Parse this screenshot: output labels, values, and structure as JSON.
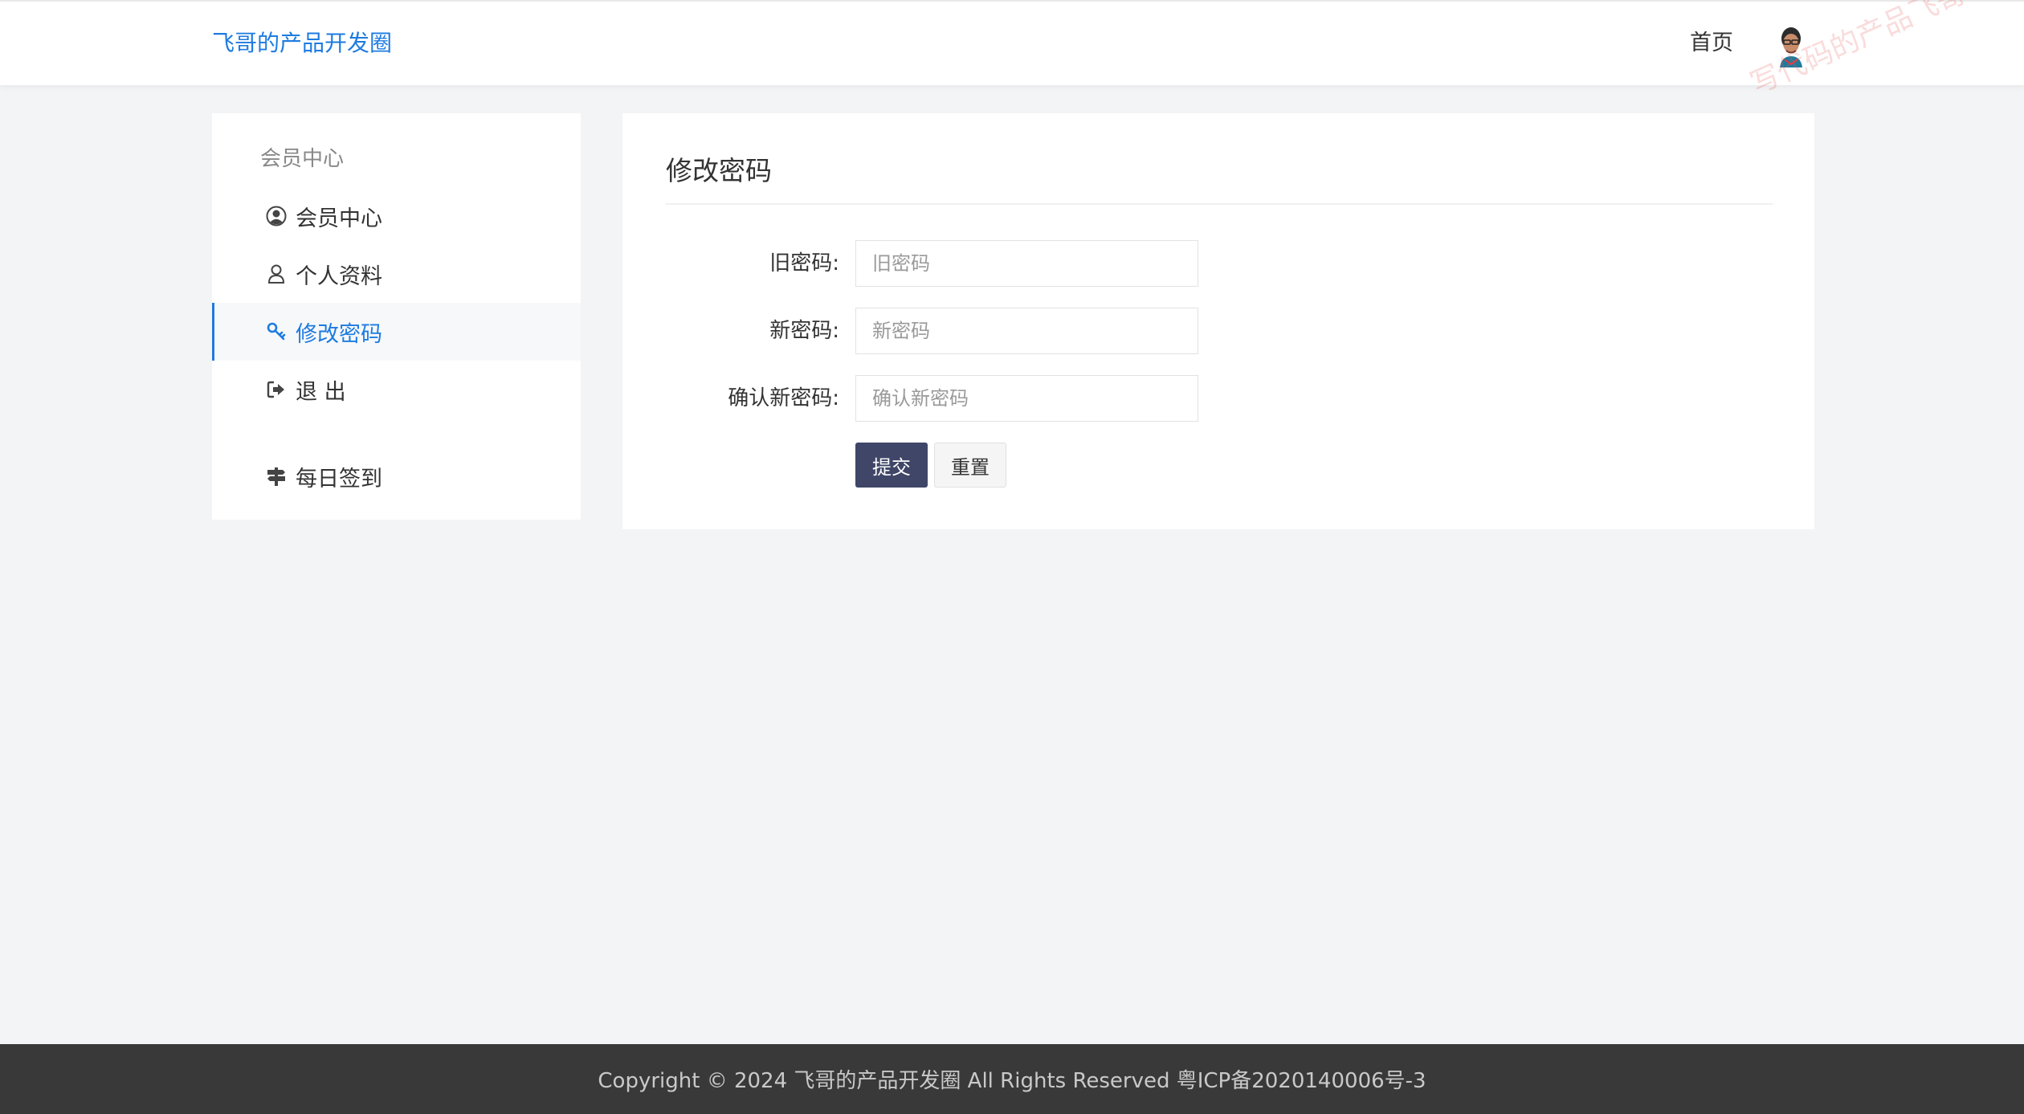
{
  "header": {
    "logo": "飞哥的产品开发圈",
    "nav_home": "首页",
    "watermark": "写代码的产品飞哥"
  },
  "sidebar": {
    "title": "会员中心",
    "items": [
      {
        "label": "会员中心",
        "icon": "user-circle-icon"
      },
      {
        "label": "个人资料",
        "icon": "user-icon"
      },
      {
        "label": "修改密码",
        "icon": "key-icon",
        "active": true
      },
      {
        "label": "退 出",
        "icon": "sign-out-icon"
      },
      {
        "label": "每日签到",
        "icon": "signpost-icon"
      }
    ]
  },
  "main": {
    "title": "修改密码",
    "fields": [
      {
        "label": "旧密码:",
        "placeholder": "旧密码",
        "value": ""
      },
      {
        "label": "新密码:",
        "placeholder": "新密码",
        "value": ""
      },
      {
        "label": "确认新密码:",
        "placeholder": "确认新密码",
        "value": ""
      }
    ],
    "submit_label": "提交",
    "reset_label": "重置"
  },
  "footer": {
    "text": "Copyright © 2024 飞哥的产品开发圈 All Rights Reserved 粤ICP备2020140006号-3"
  },
  "colors": {
    "accent": "#1e7be0",
    "submit_bg": "#3f4667",
    "footer_bg": "#393939",
    "page_bg": "#f3f4f6"
  }
}
